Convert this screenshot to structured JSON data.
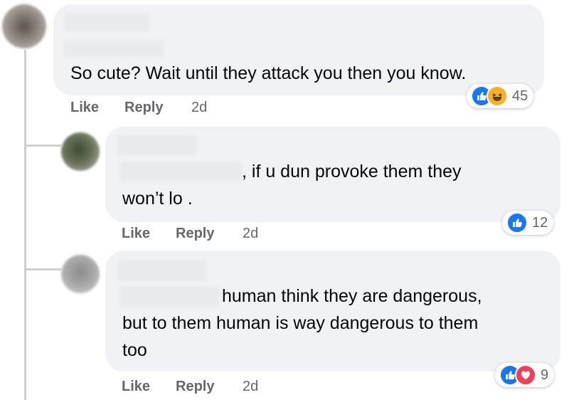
{
  "comments": [
    {
      "text": "So cute? Wait until they attack you then you know.",
      "actions": {
        "like": "Like",
        "reply": "Reply",
        "time": "2d"
      },
      "reactions": {
        "icons": [
          "like-icon",
          "haha-icon"
        ],
        "count": "45"
      }
    },
    {
      "text_line1": ", if u dun provoke them they",
      "text_line2": "won’t lo .",
      "actions": {
        "like": "Like",
        "reply": "Reply",
        "time": "2d"
      },
      "reactions": {
        "icons": [
          "like-icon"
        ],
        "count": "12"
      }
    },
    {
      "text_line1": "human think they are dangerous,",
      "text_line2": "but to them human is way dangerous to them",
      "text_line3": "too",
      "actions": {
        "like": "Like",
        "reply": "Reply",
        "time": "2d"
      },
      "reactions": {
        "icons": [
          "like-icon",
          "love-icon"
        ],
        "count": "9"
      }
    }
  ],
  "colors": {
    "bubble": "#f0f2f5",
    "meta": "#65676b",
    "like": "#1877f2",
    "love": "#f33e58",
    "haha": "#f7b125"
  }
}
